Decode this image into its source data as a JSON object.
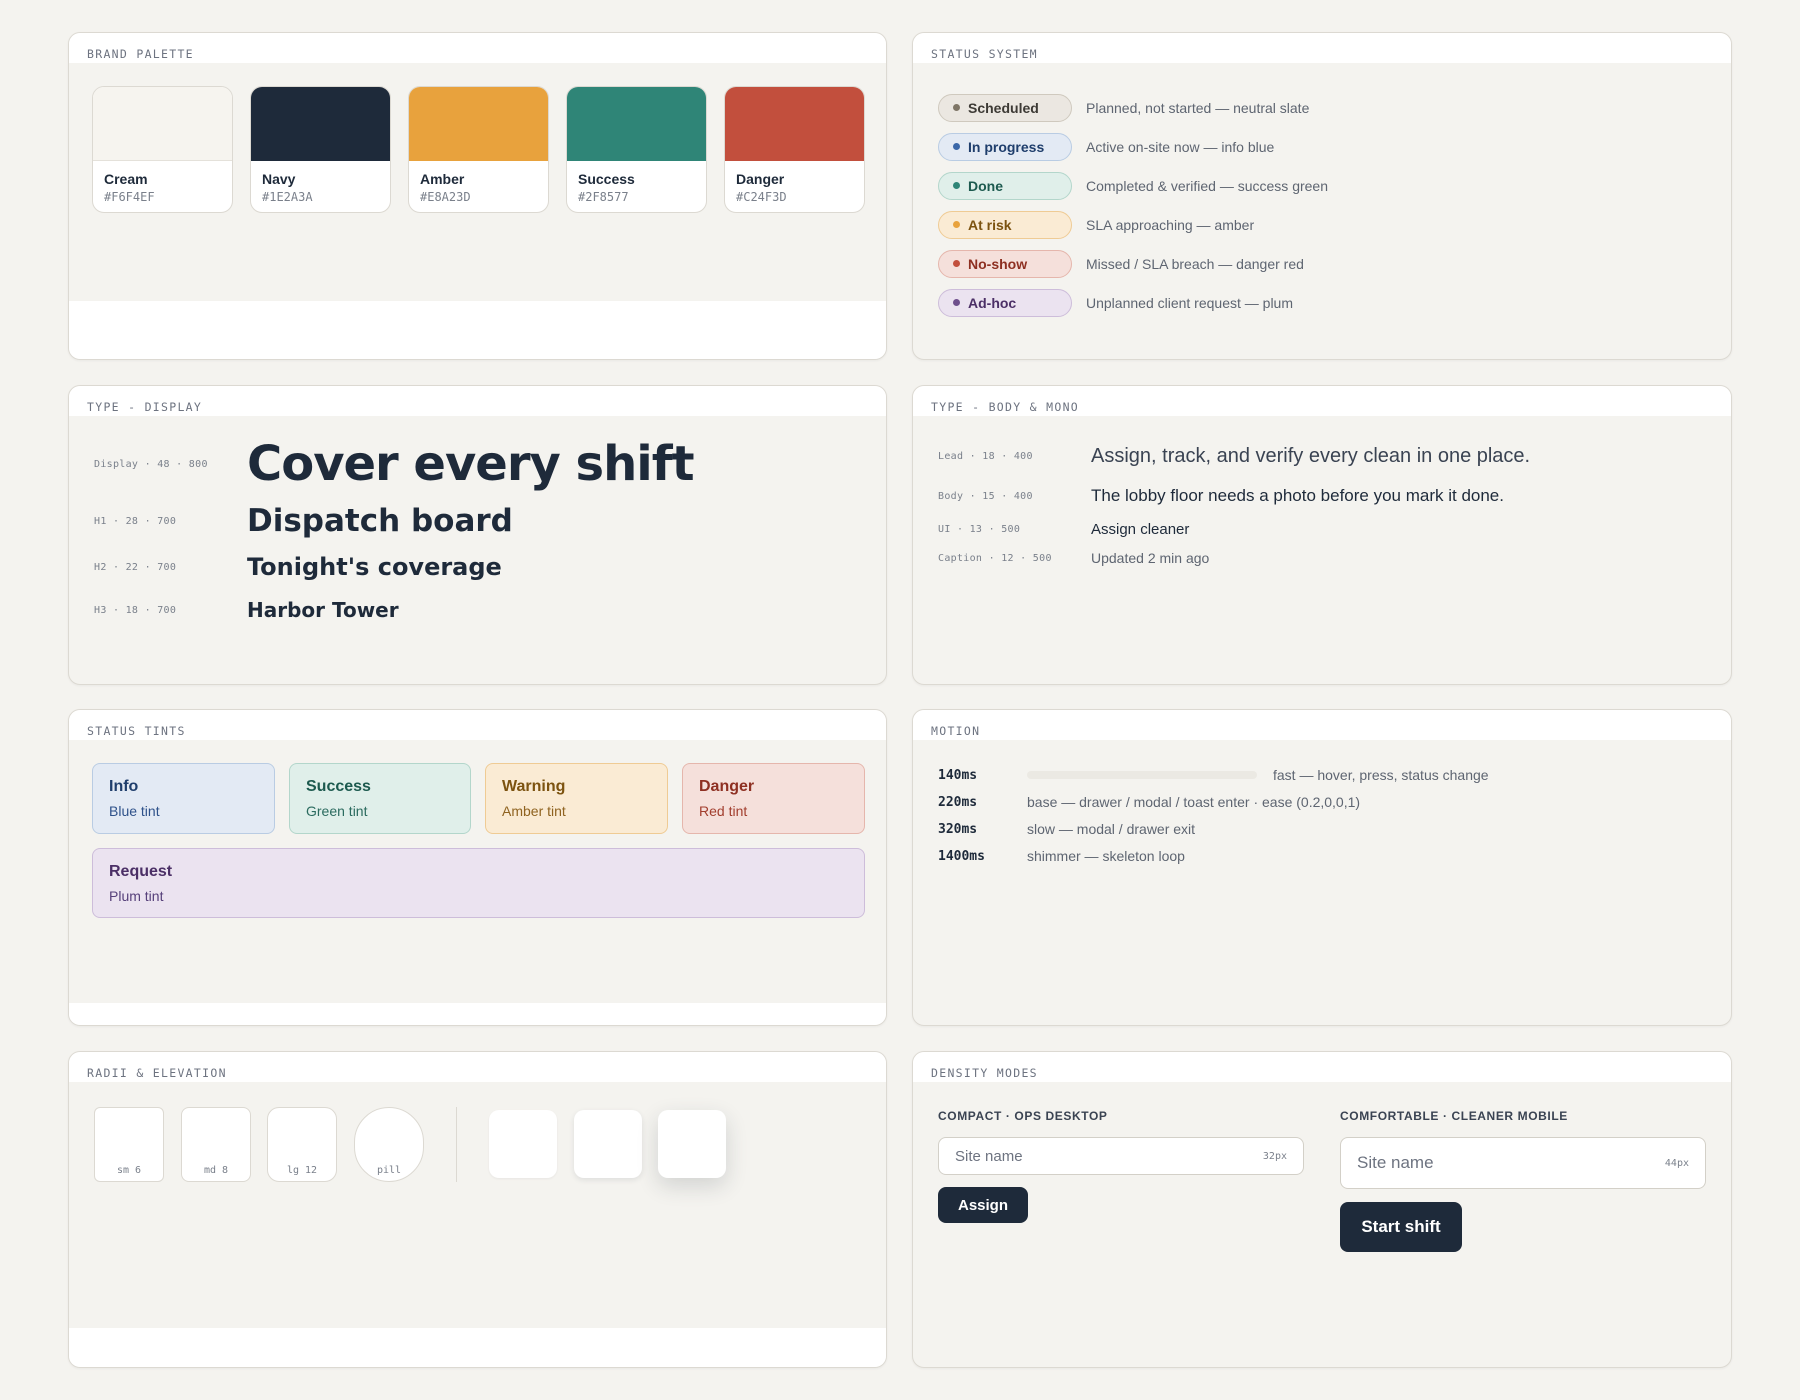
{
  "palette": {
    "heading": "BRAND PALETTE",
    "swatches": [
      {
        "name": "Cream",
        "hex": "#F6F4EF"
      },
      {
        "name": "Navy",
        "hex": "#1E2A3A"
      },
      {
        "name": "Amber",
        "hex": "#E8A23D"
      },
      {
        "name": "Success",
        "hex": "#2F8577"
      },
      {
        "name": "Danger",
        "hex": "#C24F3D"
      }
    ]
  },
  "status_system": {
    "heading": "STATUS SYSTEM",
    "items": [
      {
        "label": "Scheduled",
        "desc": "Planned, not started — neutral slate",
        "bg": "#EBE7E1",
        "border": "#CFC9BE",
        "dot": "#7E7566",
        "text": "#3D3A35"
      },
      {
        "label": "In progress",
        "desc": "Active on-site now — info blue",
        "bg": "#E3EAF4",
        "border": "#B9CCE3",
        "dot": "#3B67A8",
        "text": "#1F3E6C"
      },
      {
        "label": "Done",
        "desc": "Completed & verified — success green",
        "bg": "#E0EFEA",
        "border": "#B3D6CB",
        "dot": "#2F8577",
        "text": "#1D5A4F"
      },
      {
        "label": "At risk",
        "desc": "SLA approaching — amber",
        "bg": "#FAEBD4",
        "border": "#EFCB94",
        "dot": "#E8A23D",
        "text": "#7C5310"
      },
      {
        "label": "No-show",
        "desc": "Missed / SLA breach — danger red",
        "bg": "#F5E0DB",
        "border": "#E5B6AC",
        "dot": "#C24F3D",
        "text": "#8E3022"
      },
      {
        "label": "Ad-hoc",
        "desc": "Unplanned client request — plum",
        "bg": "#EBE3F0",
        "border": "#CDBDDA",
        "dot": "#6E4F8C",
        "text": "#4B2F66"
      }
    ]
  },
  "type_display": {
    "heading": "TYPE - DISPLAY",
    "rows": [
      {
        "label": "Display · 48 · 800",
        "text": "Cover every shift"
      },
      {
        "label": "H1 · 28 · 700",
        "text": "Dispatch board"
      },
      {
        "label": "H2 · 22 · 700",
        "text": "Tonight's coverage"
      },
      {
        "label": "H3 · 18 · 700",
        "text": "Harbor Tower"
      }
    ]
  },
  "type_body": {
    "heading": "TYPE - BODY & MONO",
    "rows": [
      {
        "label": "Lead · 18 · 400",
        "text": "Assign, track, and verify every clean in one place."
      },
      {
        "label": "Body · 15 · 400",
        "text": "The lobby floor needs a photo before you mark it done."
      },
      {
        "label": "UI · 13 · 500",
        "text": "Assign cleaner"
      },
      {
        "label": "Caption · 12 · 500",
        "text": "Updated 2 min ago"
      }
    ]
  },
  "tints": {
    "heading": "STATUS TINTS",
    "items": [
      {
        "title": "Info",
        "sub": "Blue tint",
        "bg": "#E3EAF4",
        "border": "#B9CCE3",
        "title_color": "#1F3E6C",
        "sub_color": "#2F528A"
      },
      {
        "title": "Success",
        "sub": "Green tint",
        "bg": "#E0EFEA",
        "border": "#B3D6CB",
        "title_color": "#1D5A4F",
        "sub_color": "#2B6B5F"
      },
      {
        "title": "Warning",
        "sub": "Amber tint",
        "bg": "#FAEBD4",
        "border": "#EFCB94",
        "title_color": "#7C5310",
        "sub_color": "#8F6320"
      },
      {
        "title": "Danger",
        "sub": "Red tint",
        "bg": "#F5E0DB",
        "border": "#E5B6AC",
        "title_color": "#8E3022",
        "sub_color": "#A23E2E"
      },
      {
        "title": "Request",
        "sub": "Plum tint",
        "bg": "#EBE3F0",
        "border": "#CDBDDA",
        "title_color": "#4B2F66",
        "sub_color": "#56407A"
      }
    ]
  },
  "motion": {
    "heading": "MOTION",
    "rows": [
      {
        "duration": "140ms",
        "desc": "fast — hover, press, status change"
      },
      {
        "duration": "220ms",
        "desc": "base — drawer / modal / toast enter · ease (0.2,0,0,1)"
      },
      {
        "duration": "320ms",
        "desc": "slow — modal / drawer exit"
      },
      {
        "duration": "1400ms",
        "desc": "shimmer — skeleton loop"
      }
    ]
  },
  "radii": {
    "heading": "RADII & ELEVATION",
    "items": [
      {
        "label": "sm 6"
      },
      {
        "label": "md 8"
      },
      {
        "label": "lg 12"
      },
      {
        "label": "pill"
      }
    ]
  },
  "density": {
    "heading": "DENSITY MODES",
    "compact": {
      "label": "COMPACT · OPS DESKTOP",
      "placeholder": "Site name",
      "size": "32px",
      "button": "Assign"
    },
    "comfortable": {
      "label": "COMFORTABLE · CLEANER MOBILE",
      "placeholder": "Site name",
      "size": "44px",
      "button": "Start shift"
    }
  }
}
